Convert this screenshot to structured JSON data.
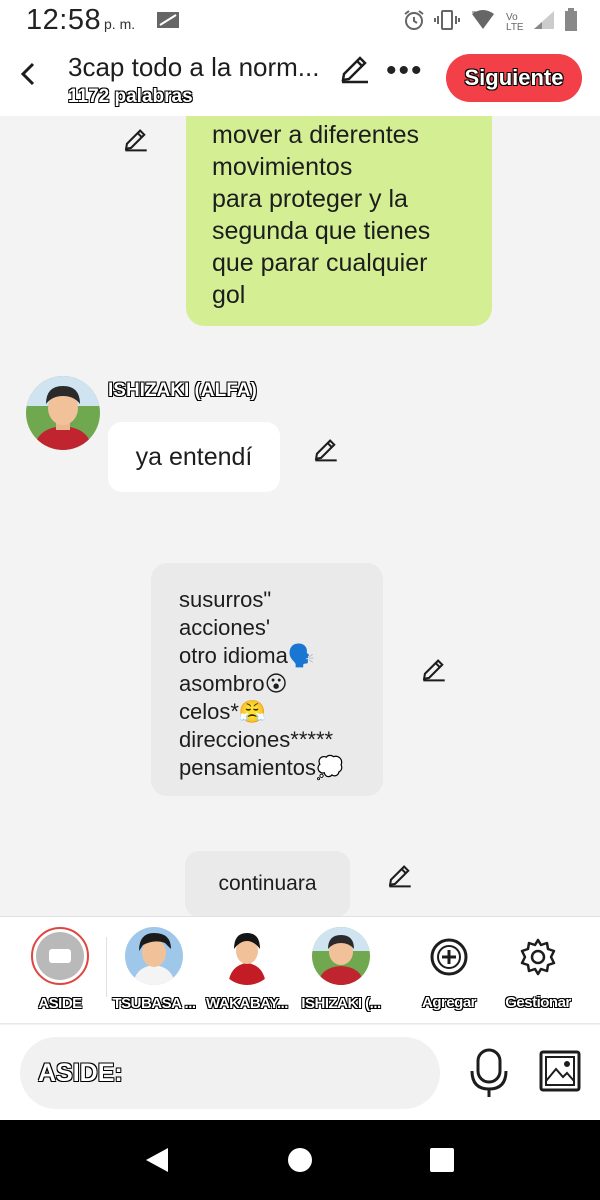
{
  "status_bar": {
    "time": "12:58",
    "ampm": "p. m.",
    "network": "Vo LTE"
  },
  "header": {
    "title": "3cap todo a la norm...",
    "word_count": "1172 palabras",
    "next_label": "Siguiente",
    "more_label": "•••"
  },
  "messages": {
    "green_bubble": "mover a diferentes\nmovimientos\npara proteger y la\nsegunda que tienes\nque parar cualquier\ngol",
    "speaker_name": "ISHIZAKI (ALFA)",
    "white_bubble": "ya entendí",
    "aside_lines": [
      "susurros\"",
      "acciones'",
      "otro idioma🗣️",
      "asombro😮",
      "celos*😤",
      "direcciones*****",
      "pensamientos💭"
    ],
    "continue_bubble": "continuara"
  },
  "characters": [
    {
      "label": "ASIDE"
    },
    {
      "label": "TSUBASA ..."
    },
    {
      "label": "WAKABAY..."
    },
    {
      "label": "ISHIZAKI (..."
    },
    {
      "label": "Agregar"
    },
    {
      "label": "Gestionar"
    }
  ],
  "input": {
    "placeholder": "ASIDE:"
  },
  "colors": {
    "accent_red": "#f23f48",
    "green_bubble": "#d4ef93",
    "background": "#f3f3f3"
  }
}
